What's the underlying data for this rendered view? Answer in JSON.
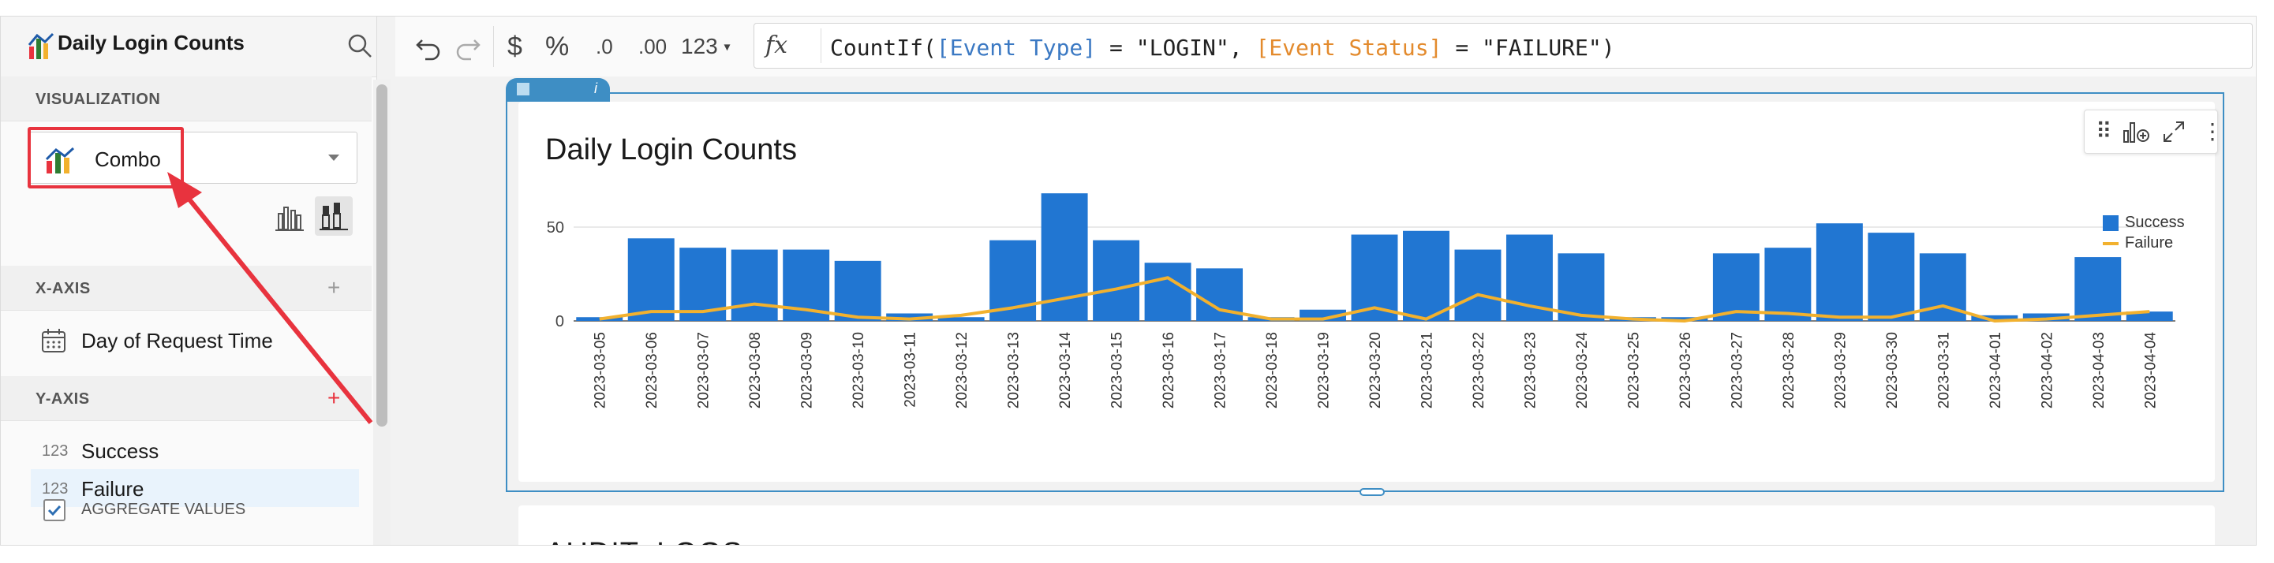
{
  "app": {
    "sheet_title": "Daily Login Counts"
  },
  "left_panel": {
    "sections": {
      "visualization": "VISUALIZATION",
      "x_axis": "X-AXIS",
      "y_axis": "Y-AXIS"
    },
    "viz_type": "Combo",
    "x_axis_field": "Day of Request Time",
    "y_axis_fields": [
      {
        "type_label": "123",
        "name": "Success"
      },
      {
        "type_label": "123",
        "name": "Failure"
      }
    ],
    "aggregate_values_label": "AGGREGATE VALUES",
    "plus_symbol": "+"
  },
  "toolbar": {
    "undo_icon": "undo-icon",
    "redo_icon": "redo-icon",
    "currency_label": "$",
    "percent_label": "%",
    "decrease_decimals_label": ".0",
    "increase_decimals_label": ".00",
    "number_format_label": "123",
    "fx_label": "fx",
    "formula_parts": {
      "fn": "CountIf(",
      "field1": "[Event Type]",
      "mid1": " = \"LOGIN\", ",
      "field2": "[Event Status]",
      "mid2": " = \"FAILURE\")"
    }
  },
  "chart": {
    "title": "Daily Login Counts",
    "second_card_title": "AUDIT_LOGS",
    "colors": {
      "success": "#2176d2",
      "failure": "#f2b12e",
      "accent": "#3e8ec4",
      "annotation": "#e8333e"
    }
  },
  "chart_data": {
    "type": "bar",
    "title": "Daily Login Counts",
    "xlabel": "",
    "ylabel": "",
    "ylim": [
      0,
      50
    ],
    "yticks": [
      0,
      50
    ],
    "legend": "top-right",
    "grid": true,
    "categories": [
      "2023-03-05",
      "2023-03-06",
      "2023-03-07",
      "2023-03-08",
      "2023-03-09",
      "2023-03-10",
      "2023-03-11",
      "2023-03-12",
      "2023-03-13",
      "2023-03-14",
      "2023-03-15",
      "2023-03-16",
      "2023-03-17",
      "2023-03-18",
      "2023-03-19",
      "2023-03-20",
      "2023-03-21",
      "2023-03-22",
      "2023-03-23",
      "2023-03-24",
      "2023-03-25",
      "2023-03-26",
      "2023-03-27",
      "2023-03-28",
      "2023-03-29",
      "2023-03-30",
      "2023-03-31",
      "2023-04-01",
      "2023-04-02",
      "2023-04-03",
      "2023-04-04"
    ],
    "series": [
      {
        "name": "Success",
        "type": "bar",
        "values": [
          2,
          44,
          39,
          38,
          38,
          32,
          4,
          2,
          43,
          68,
          43,
          31,
          28,
          2,
          6,
          46,
          48,
          38,
          46,
          36,
          2,
          2,
          36,
          39,
          52,
          47,
          36,
          3,
          4,
          34,
          5
        ]
      },
      {
        "name": "Failure",
        "type": "line",
        "values": [
          1,
          5,
          5,
          9,
          6,
          2,
          1,
          3,
          7,
          12,
          17,
          23,
          6,
          1,
          1,
          7,
          1,
          14,
          8,
          3,
          1,
          0,
          5,
          4,
          2,
          2,
          8,
          0,
          1,
          3,
          5
        ]
      }
    ]
  }
}
